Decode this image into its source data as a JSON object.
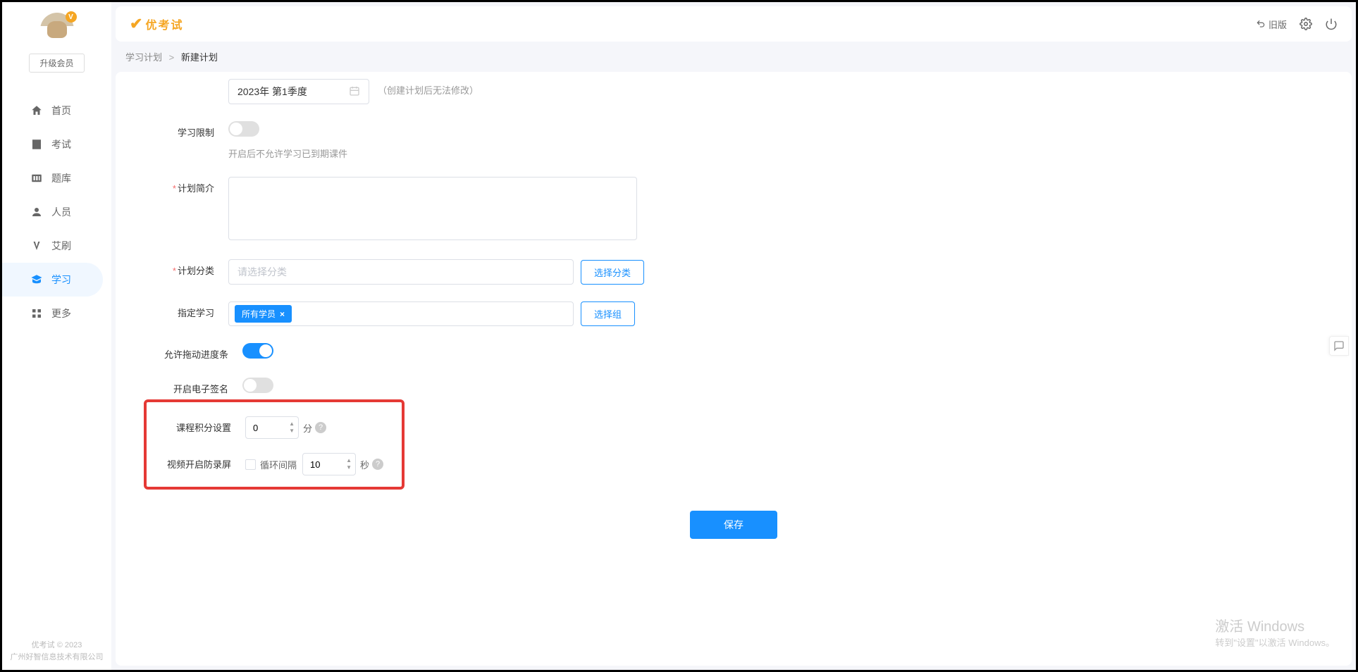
{
  "sidebar": {
    "badge": "V",
    "upgrade": "升级会员",
    "nav": [
      {
        "label": "首页",
        "icon": "home"
      },
      {
        "label": "考试",
        "icon": "exam"
      },
      {
        "label": "题库",
        "icon": "bank"
      },
      {
        "label": "人员",
        "icon": "user"
      },
      {
        "label": "艾刷",
        "icon": "ai"
      },
      {
        "label": "学习",
        "icon": "study"
      },
      {
        "label": "更多",
        "icon": "more"
      }
    ],
    "footer1": "优考试 © 2023",
    "footer2": "广州好智信息技术有限公司"
  },
  "topbar": {
    "logo": "优考试",
    "old_version": "旧版"
  },
  "breadcrumb": {
    "parent": "学习计划",
    "current": "新建计划"
  },
  "form": {
    "period_value": "2023年 第1季度",
    "period_hint": "（创建计划后无法修改）",
    "restrict_label": "学习限制",
    "restrict_hint": "开启后不允许学习已到期课件",
    "desc_label": "计划简介",
    "desc_value": "",
    "category_label": "计划分类",
    "category_placeholder": "请选择分类",
    "category_btn": "选择分类",
    "assign_label": "指定学习",
    "assign_tag": "所有学员",
    "assign_btn": "选择组",
    "drag_label": "允许拖动进度条",
    "sign_label": "开启电子签名",
    "points_label": "课程积分设置",
    "points_value": "0",
    "points_unit": "分",
    "antirecord_label": "视频开启防录屏",
    "loop_label": "循环间隔",
    "loop_value": "10",
    "loop_unit": "秒",
    "save": "保存"
  },
  "watermark": {
    "line1": "激活 Windows",
    "line2": "转到\"设置\"以激活 Windows。"
  }
}
